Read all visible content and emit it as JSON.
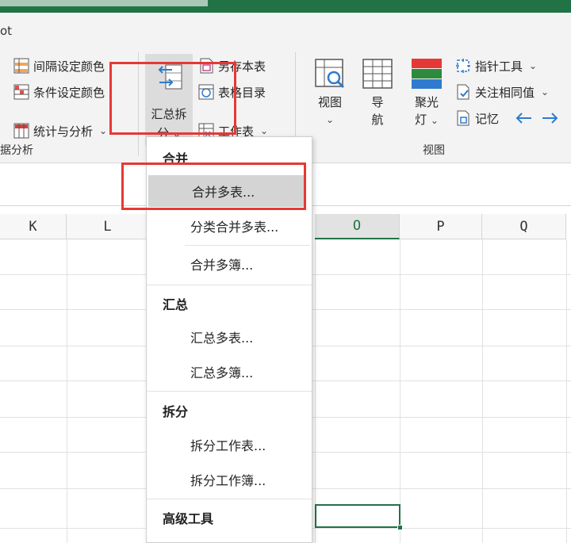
{
  "ribbon": {
    "tab_partial": "ot",
    "left_group": {
      "items": [
        {
          "label": "间隔设定颜色"
        },
        {
          "label": "条件设定颜色"
        },
        {
          "label": "统计与分析"
        }
      ],
      "group_label": "据分析"
    },
    "summary_button": {
      "line1": "汇总拆",
      "line2": "分"
    },
    "file_group": {
      "items": [
        {
          "label": "另存本表"
        },
        {
          "label": "表格目录"
        },
        {
          "label": "工作表"
        }
      ]
    },
    "view_group": {
      "view": {
        "line1": "视图"
      },
      "nav": {
        "line1": "导",
        "line2": "航"
      },
      "spotlight": {
        "line1": "聚光",
        "line2": "灯"
      },
      "items": [
        {
          "label": "指针工具"
        },
        {
          "label": "关注相同值"
        },
        {
          "label": "记忆"
        }
      ],
      "group_label": "视图"
    }
  },
  "columns": [
    {
      "name": "K"
    },
    {
      "name": "L"
    },
    {
      "name": "O"
    },
    {
      "name": "P"
    },
    {
      "name": "Q"
    }
  ],
  "menu": {
    "sections": [
      {
        "title": "合并",
        "items": [
          "合并多表...",
          "分类合并多表...",
          "合并多簿..."
        ]
      },
      {
        "title": "汇总",
        "items": [
          "汇总多表...",
          "汇总多簿..."
        ]
      },
      {
        "title": "拆分",
        "items": [
          "拆分工作表...",
          "拆分工作簿..."
        ]
      },
      {
        "title": "高级工具",
        "items": []
      }
    ]
  },
  "colors": {
    "accent": "#217346",
    "highlight_box": "#e53935",
    "arrow": "#2e7bcf"
  }
}
